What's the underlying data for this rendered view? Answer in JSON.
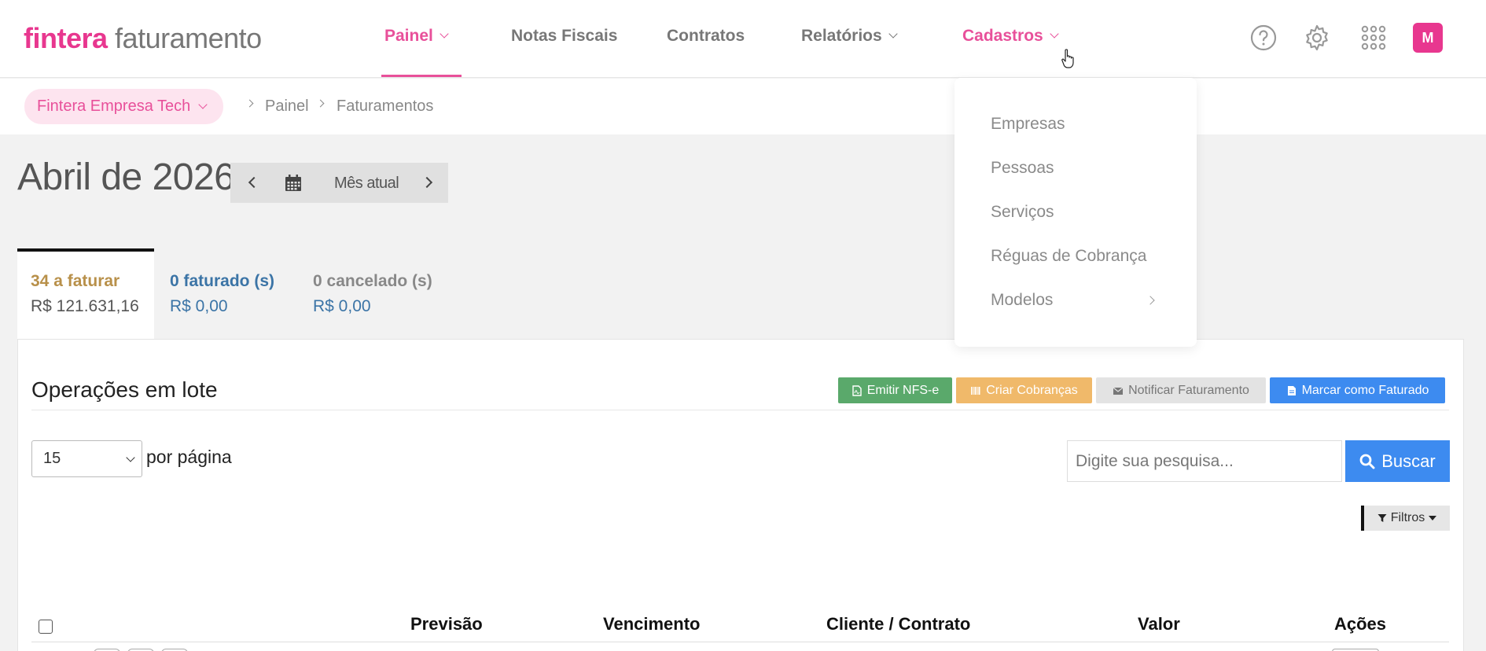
{
  "logo": {
    "brand": "fintera",
    "product": "faturamento"
  },
  "nav": {
    "items": [
      {
        "label": "Painel"
      },
      {
        "label": "Notas Fiscais"
      },
      {
        "label": "Contratos"
      },
      {
        "label": "Relatórios"
      },
      {
        "label": "Cadastros"
      }
    ],
    "avatar_initial": "M"
  },
  "company_selector": "Fintera Empresa Tech",
  "breadcrumb": [
    "Painel",
    "Faturamentos"
  ],
  "month": {
    "title": "Abril de 2026",
    "current_label": "Mês atual"
  },
  "status_tabs": [
    {
      "count": "34 a faturar",
      "amount": "R$ 121.631,16",
      "color": "#b8904a"
    },
    {
      "count": "0 faturado (s)",
      "amount": "R$ 0,00",
      "color": "#3b74a6"
    },
    {
      "count": "0 cancelado (s)",
      "amount": "R$ 0,00",
      "color": "#888888"
    }
  ],
  "batch": {
    "title": "Operações em lote",
    "buttons": [
      {
        "label": "Emitir NFS-e",
        "color": "#5aa96b",
        "icon": "file-pdf-icon"
      },
      {
        "label": "Criar Cobranças",
        "color": "#f0b96a",
        "icon": "barcode-icon"
      },
      {
        "label": "Notificar Faturamento",
        "color": "#e3e3e3",
        "icon": "envelope-icon"
      },
      {
        "label": "Marcar como Faturado",
        "color": "#3d8bf0",
        "icon": "file-icon"
      }
    ]
  },
  "pagination": {
    "per_page_value": "15",
    "per_page_label": "por página"
  },
  "search": {
    "placeholder": "Digite sua pesquisa...",
    "button_label": "Buscar"
  },
  "filters_label": "Filtros",
  "table": {
    "headers": [
      "Previsão",
      "Vencimento",
      "Cliente / Contrato",
      "Valor",
      "Ações"
    ]
  },
  "cadastros_menu": [
    "Empresas",
    "Pessoas",
    "Serviços",
    "Réguas de Cobrança",
    "Modelos"
  ],
  "colors": {
    "brand_pink": "#e8378f",
    "primary_blue": "#3d8bf0"
  }
}
